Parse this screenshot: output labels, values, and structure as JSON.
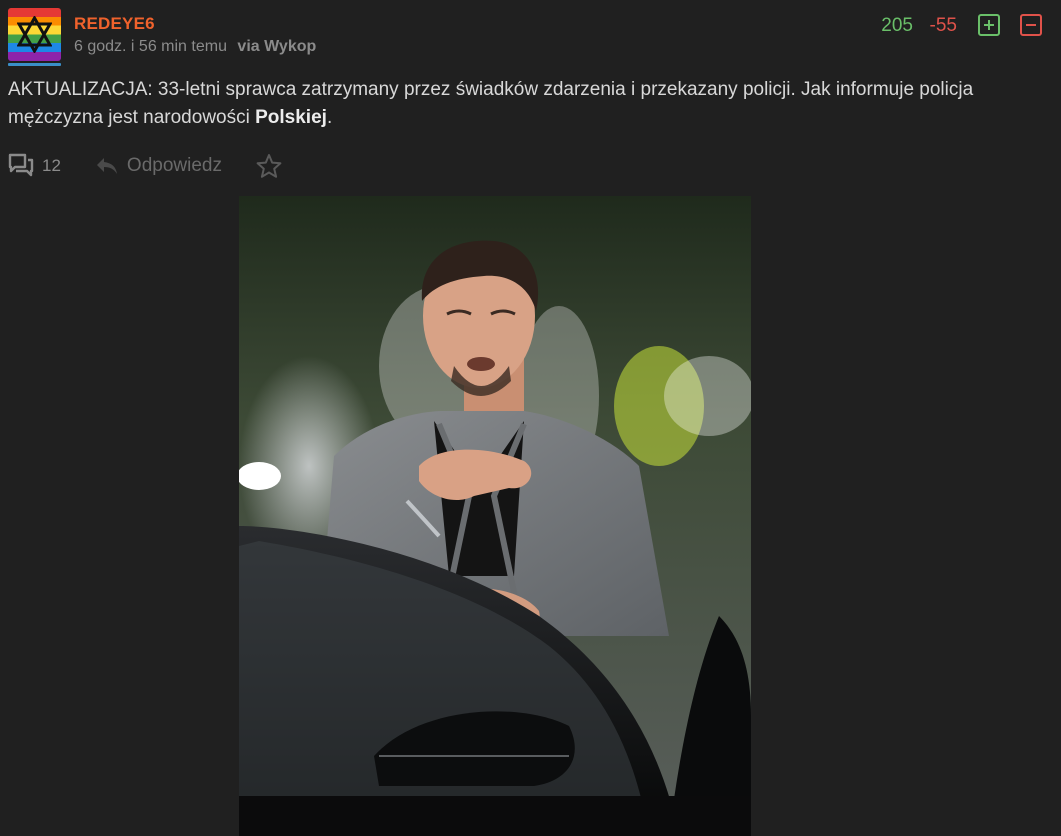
{
  "post": {
    "author": "REDEYE6",
    "time": "6 godz. i 56 min temu",
    "via": "via Wykop",
    "votes_up": "205",
    "votes_down": "-55",
    "text_main": "AKTUALIZACJA: 33-letni sprawca zatrzymany przez świadków zdarzenia i przekazany policji. Jak informuje policja mężczyzna jest narodowości ",
    "text_bold": "Polskiej",
    "text_end": ".",
    "comments_count": "12",
    "reply_label": "Odpowiedz"
  },
  "icons": {
    "avatar": "rainbow-star-avatar",
    "upvote": "plus-square-icon",
    "downvote": "minus-square-icon",
    "comments": "comments-icon",
    "reply": "reply-arrow-icon",
    "favorite": "star-outline-icon"
  },
  "colors": {
    "username": "#f0622c",
    "plus": "#6abf69",
    "minus": "#e0524a",
    "background": "#202020"
  }
}
